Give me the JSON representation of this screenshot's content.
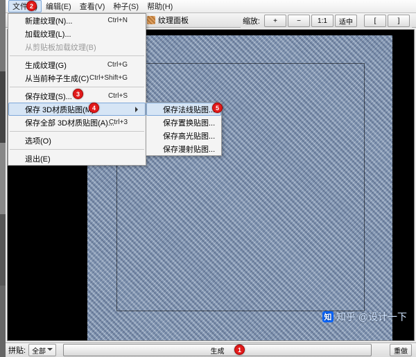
{
  "menubar": {
    "items": [
      "文件(F)",
      "编辑(E)",
      "查看(V)",
      "种子(S)",
      "帮助(H)"
    ]
  },
  "panel": {
    "tab_label": "纹理面板"
  },
  "zoom": {
    "label": "缩放:",
    "buttons": {
      "plus": "+",
      "minus": "−",
      "oneone": "1:1",
      "fit": "适中",
      "bl": "[",
      "br": "]"
    }
  },
  "file_menu": {
    "items": [
      {
        "label": "新建纹理(N)...",
        "accel": "Ctrl+N"
      },
      {
        "label": "加载纹理(L)..."
      },
      {
        "label": "从剪贴板加载纹理(B)",
        "disabled": true
      },
      {
        "sep": true
      },
      {
        "label": "生成纹理(G)",
        "accel": "Ctrl+G"
      },
      {
        "label": "从当前种子生成(C)",
        "accel": "Ctrl+Shift+G"
      },
      {
        "sep": true
      },
      {
        "label": "保存纹理(S)...",
        "accel": "Ctrl+S"
      },
      {
        "label": "保存 3D材质贴图(M)",
        "submenu": true,
        "hover": true
      },
      {
        "label": "保存全部 3D材质贴图(A)...",
        "accel": "Ctrl+3"
      },
      {
        "sep": true
      },
      {
        "label": "选项(O)"
      },
      {
        "sep": true
      },
      {
        "label": "退出(E)"
      }
    ]
  },
  "submenu": {
    "items": [
      {
        "label": "保存法线贴图...",
        "hover": true
      },
      {
        "label": "保存置换贴图..."
      },
      {
        "label": "保存高光贴图..."
      },
      {
        "label": "保存漫射贴图..."
      }
    ]
  },
  "footer": {
    "preset_label": "拼贴:",
    "preset_value": "全部",
    "generate": "生成",
    "undo": "重做"
  },
  "callouts": {
    "c1": "1",
    "c2": "2",
    "c3": "3",
    "c4": "4",
    "c5": "5"
  },
  "watermark": {
    "logo": "知",
    "text": "知乎 @设计一下"
  }
}
